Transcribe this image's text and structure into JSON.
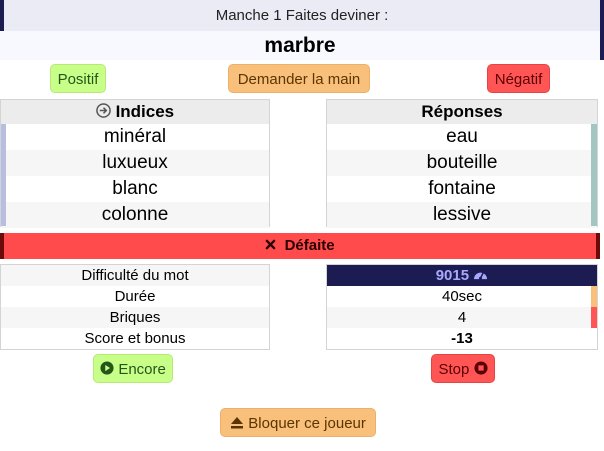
{
  "header": {
    "round_text": "Manche 1 Faites deviner :",
    "word": "marbre"
  },
  "actions": {
    "positive_label": "Positif",
    "ask_hand_label": "Demander la main",
    "negative_label": "Négatif"
  },
  "clues": {
    "title": "Indices",
    "items": [
      "minéral",
      "luxueux",
      "blanc",
      "colonne"
    ]
  },
  "answers": {
    "title": "Réponses",
    "items": [
      "eau",
      "bouteille",
      "fontaine",
      "lessive"
    ]
  },
  "result": {
    "label": "Défaite"
  },
  "stats": {
    "labels": [
      "Difficulté du mot",
      "Durée",
      "Briques",
      "Score et bonus"
    ],
    "values": [
      "9015",
      "40sec",
      "4",
      "-13"
    ]
  },
  "controls": {
    "encore_label": "Encore",
    "stop_label": "Stop",
    "block_label": "Bloquer ce joueur"
  },
  "colors": {
    "accent_dark": "#1c1b52",
    "green": "#c8ff88",
    "orange": "#f8c07a",
    "red": "#ff5555"
  },
  "icons": [
    "circle-arrow-right-icon",
    "x-icon",
    "gauge-icon",
    "play-circle-icon",
    "stop-circle-icon",
    "eject-icon"
  ]
}
